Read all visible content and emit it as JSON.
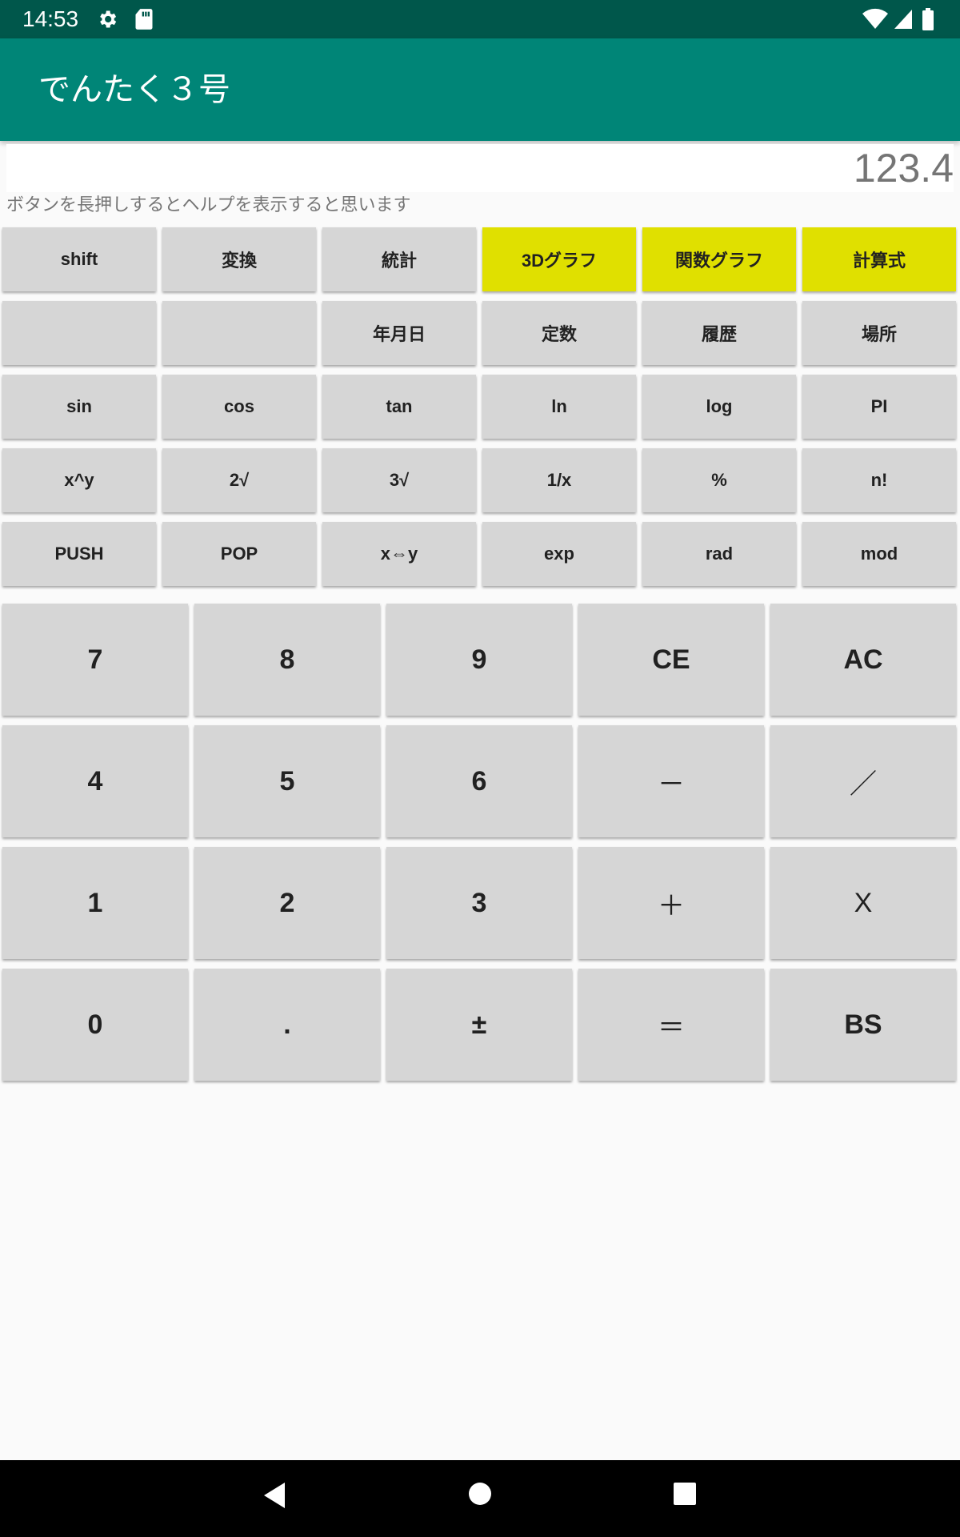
{
  "status_bar": {
    "time": "14:53",
    "icons": [
      "settings-icon",
      "sd-card-icon",
      "wifi-icon",
      "signal-icon",
      "battery-icon"
    ]
  },
  "app_bar": {
    "title": "でんたく３号"
  },
  "display": {
    "value": "123.4"
  },
  "help_text": "ボタンを長押しするとヘルプを表示すると思います",
  "function_rows": [
    [
      "shift",
      "変換",
      "統計",
      "3Dグラフ",
      "関数グラフ",
      "計算式"
    ],
    [
      "",
      "",
      "年月日",
      "定数",
      "履歴",
      "場所"
    ],
    [
      "sin",
      "cos",
      "tan",
      "ln",
      "log",
      "PI"
    ],
    [
      "x^y",
      "2√",
      "3√",
      "1/x",
      "%",
      "n!"
    ],
    [
      "PUSH",
      "POP",
      "x⇔y",
      "exp",
      "rad",
      "mod"
    ]
  ],
  "number_rows": [
    [
      "7",
      "8",
      "9",
      "CE",
      "AC"
    ],
    [
      "4",
      "5",
      "6",
      "－",
      "／"
    ],
    [
      "1",
      "2",
      "3",
      "＋",
      "X"
    ],
    [
      "0",
      ".",
      "±",
      "＝",
      "BS"
    ]
  ],
  "colors": {
    "status_bar": "#00574b",
    "app_bar": "#008577",
    "button": "#d6d6d6",
    "highlight_button": "#e0e000"
  },
  "nav_bar": {
    "icons": [
      "back-icon",
      "home-icon",
      "recents-icon"
    ]
  }
}
